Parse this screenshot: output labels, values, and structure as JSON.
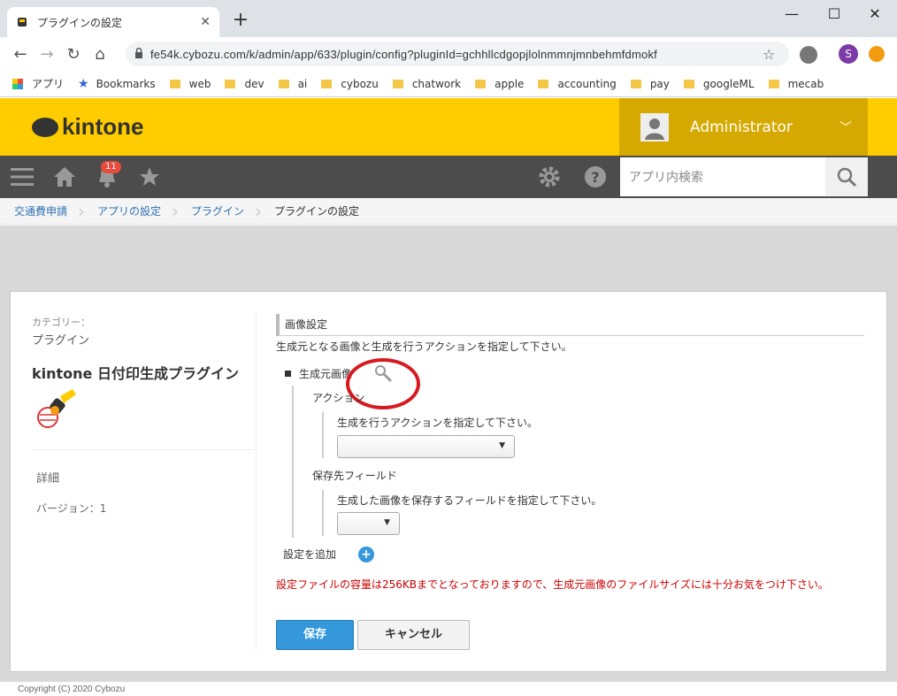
{
  "browser": {
    "tab_title": "プラグインの設定",
    "url": "fe54k.cybozu.com/k/admin/app/633/plugin/config?pluginId=gchhllcdgopjlolnmmnjmnbehmfdmokf",
    "profile_initial": "S",
    "bookmarks": [
      "アプリ",
      "Bookmarks",
      "web",
      "dev",
      "ai",
      "cybozu",
      "chatwork",
      "apple",
      "accounting",
      "pay",
      "googleML",
      "mecab"
    ]
  },
  "header": {
    "logo": "kintone",
    "user_name": "Administrator",
    "notification_count": "11",
    "search_placeholder": "アプリ内検索"
  },
  "breadcrumb": {
    "items": [
      "交通費申請",
      "アプリの設定",
      "プラグイン",
      "プラグインの設定"
    ]
  },
  "plugin": {
    "category_label": "カテゴリー：",
    "category_value": "プラグイン",
    "name": "kintone 日付印生成プラグイン",
    "detail_link": "詳細",
    "version": "バージョン：1"
  },
  "settings": {
    "section_title": "画像設定",
    "section_desc": "生成元となる画像と生成を行うアクションを指定して下さい。",
    "source_image_label": "生成元画像",
    "action_label": "アクション",
    "action_desc": "生成を行うアクションを指定して下さい。",
    "action_value": "",
    "field_label": "保存先フィールド",
    "field_desc": "生成した画像を保存するフィールドを指定して下さい。",
    "field_value": "",
    "add_label": "設定を追加",
    "warning": "設定ファイルの容量は256KBまでとなっておりますので、生成元画像のファイルサイズには十分お気をつけ下さい。",
    "save_label": "保存",
    "cancel_label": "キャンセル"
  },
  "footer": {
    "copyright": "Copyright (C) 2020 Cybozu"
  },
  "colors": {
    "brand_yellow": "#ffcc00",
    "primary_blue": "#3498db",
    "warning_red": "#cc0000",
    "highlight_circle": "#d71920"
  }
}
